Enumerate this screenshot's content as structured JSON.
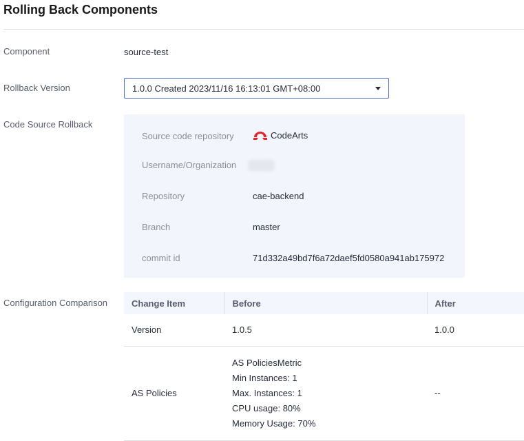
{
  "page": {
    "title": "Rolling Back Components"
  },
  "component": {
    "label": "Component",
    "value": "source-test"
  },
  "rollback_version": {
    "label": "Rollback Version",
    "selected": "1.0.0 Created 2023/11/16 16:13:01 GMT+08:00"
  },
  "code_source": {
    "label": "Code Source Rollback",
    "fields": [
      {
        "label": "Source code repository",
        "value": "CodeArts",
        "icon": "codearts-logo-icon"
      },
      {
        "label": "Username/Organization",
        "value": ""
      },
      {
        "label": "Repository",
        "value": "cae-backend"
      },
      {
        "label": "Branch",
        "value": "master"
      },
      {
        "label": "commit id",
        "value": "71d332a49bd7f6a72daef5fd0580a941ab175972"
      }
    ]
  },
  "config_comparison": {
    "label": "Configuration Comparison",
    "columns": [
      "Change Item",
      "Before",
      "After"
    ],
    "rows": [
      {
        "item": "Version",
        "before": "1.0.5",
        "after": "1.0.0"
      },
      {
        "item": "AS Policies",
        "before_lines": [
          "AS PoliciesMetric",
          "Min Instances:  1",
          "Max. Instances: 1",
          "CPU usage:  80%",
          "Memory Usage:  70%"
        ],
        "after": "--"
      }
    ]
  },
  "colors": {
    "accent": "#526ecc",
    "codearts_red": "#e0262a",
    "panel_bg": "#f2f5fc"
  }
}
